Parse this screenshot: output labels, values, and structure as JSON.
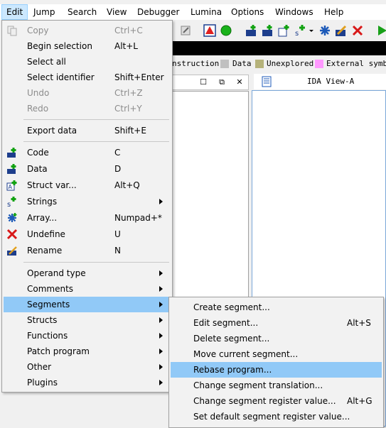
{
  "menubar": {
    "items": [
      "Edit",
      "Jump",
      "Search",
      "View",
      "Debugger",
      "Lumina",
      "Options",
      "Windows",
      "Help"
    ]
  },
  "legend": {
    "items": [
      {
        "label": "nstruction",
        "color": ""
      },
      {
        "label": "Data",
        "color": "#c0c0c0"
      },
      {
        "label": "Unexplored",
        "color": "#b5b27a"
      },
      {
        "label": "External symbo",
        "color": "#ff99ff"
      }
    ]
  },
  "ida_view": {
    "title": "IDA View-A"
  },
  "edit_menu": {
    "items": [
      {
        "label": "Copy",
        "shortcut": "Ctrl+C",
        "disabled": true,
        "icon": "copy-icon"
      },
      {
        "label": "Begin selection",
        "shortcut": "Alt+L"
      },
      {
        "label": "Select all",
        "shortcut": ""
      },
      {
        "label": "Select identifier",
        "shortcut": "Shift+Enter"
      },
      {
        "label": "Undo",
        "shortcut": "Ctrl+Z",
        "disabled": true
      },
      {
        "label": "Redo",
        "shortcut": "Ctrl+Y",
        "disabled": true
      },
      {
        "label": "Export data",
        "shortcut": "Shift+E"
      },
      {
        "label": "Code",
        "shortcut": "C",
        "icon": "code-icon"
      },
      {
        "label": "Data",
        "shortcut": "D",
        "icon": "data-icon"
      },
      {
        "label": "Struct var...",
        "shortcut": "Alt+Q",
        "icon": "struct-var-icon"
      },
      {
        "label": "Strings",
        "shortcut": "",
        "icon": "strings-icon"
      },
      {
        "label": "Array...",
        "shortcut": "Numpad+*",
        "icon": "array-icon"
      },
      {
        "label": "Undefine",
        "shortcut": "U",
        "icon": "undefine-icon"
      },
      {
        "label": "Rename",
        "shortcut": "N",
        "icon": "rename-icon"
      },
      {
        "label": "Operand type",
        "shortcut": ""
      },
      {
        "label": "Comments",
        "shortcut": ""
      },
      {
        "label": "Segments",
        "shortcut": ""
      },
      {
        "label": "Structs",
        "shortcut": ""
      },
      {
        "label": "Functions",
        "shortcut": ""
      },
      {
        "label": "Patch program",
        "shortcut": ""
      },
      {
        "label": "Other",
        "shortcut": ""
      },
      {
        "label": "Plugins",
        "shortcut": ""
      }
    ]
  },
  "segments_menu": {
    "items": [
      {
        "label": "Create segment...",
        "shortcut": ""
      },
      {
        "label": "Edit segment...",
        "shortcut": "Alt+S"
      },
      {
        "label": "Delete segment...",
        "shortcut": ""
      },
      {
        "label": "Move current segment...",
        "shortcut": ""
      },
      {
        "label": "Rebase program...",
        "shortcut": ""
      },
      {
        "label": "Change segment translation...",
        "shortcut": ""
      },
      {
        "label": "Change segment register value...",
        "shortcut": "Alt+G"
      },
      {
        "label": "Set default segment register value...",
        "shortcut": ""
      }
    ]
  },
  "colors": {
    "highlight": "#91c9f7",
    "menubar_active": "#cce8ff"
  }
}
